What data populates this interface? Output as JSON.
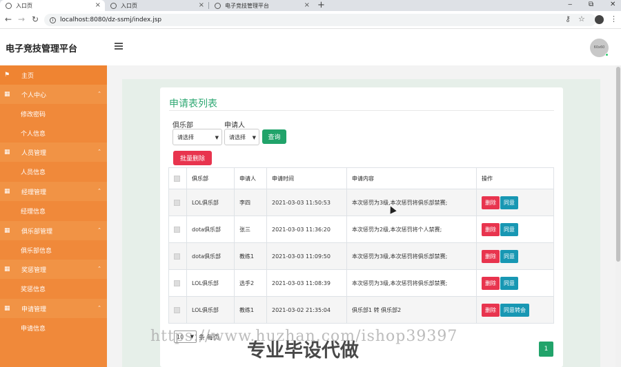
{
  "browser": {
    "tabs": [
      {
        "title": "入口页"
      },
      {
        "title": "入口页"
      },
      {
        "title": "电子竞技管理平台"
      }
    ],
    "url": "localhost:8080/dz-ssmj/index.jsp",
    "win_min": "‒",
    "win_max": "⧉",
    "win_close": "✕"
  },
  "header": {
    "brand": "电子竞技管理平台",
    "avatar_text": "60x60"
  },
  "sidebar": {
    "home": "主页",
    "groups": [
      {
        "label": "个人中心",
        "children": [
          "修改密码",
          "个人信息"
        ]
      },
      {
        "label": "人员管理",
        "children": [
          "人员信息"
        ]
      },
      {
        "label": "经理管理",
        "children": [
          "经理信息"
        ]
      },
      {
        "label": "俱乐部管理",
        "children": [
          "俱乐部信息"
        ]
      },
      {
        "label": "奖惩管理",
        "children": [
          "奖惩信息"
        ]
      },
      {
        "label": "申请管理",
        "children": [
          "申请信息"
        ]
      }
    ]
  },
  "main": {
    "title": "申请表列表",
    "filters": {
      "club_label": "俱乐部",
      "club_value": "请选择",
      "applicant_label": "申请人",
      "applicant_value": "请选择",
      "query_button": "查询"
    },
    "batch_delete": "批量删除",
    "table": {
      "headers": [
        "俱乐部",
        "申请人",
        "申请时间",
        "申请内容",
        "操作"
      ],
      "rows": [
        {
          "club": "LOL俱乐部",
          "applicant": "李四",
          "time": "2021-03-03 11:50:53",
          "content": "本次惩罚为3级,本次惩罚将俱乐部禁赛;",
          "actions": [
            "删除",
            "同意"
          ]
        },
        {
          "club": "dota俱乐部",
          "applicant": "张三",
          "time": "2021-03-03 11:36:20",
          "content": "本次惩罚为2级,本次惩罚将个人禁赛;",
          "actions": [
            "删除",
            "同意"
          ]
        },
        {
          "club": "dota俱乐部",
          "applicant": "教练1",
          "time": "2021-03-03 11:09:50",
          "content": "本次惩罚为3级,本次惩罚将俱乐部禁赛;",
          "actions": [
            "删除",
            "同意"
          ]
        },
        {
          "club": "LOL俱乐部",
          "applicant": "选手2",
          "time": "2021-03-03 11:08:39",
          "content": "本次惩罚为3级,本次惩罚将俱乐部禁赛;",
          "actions": [
            "删除",
            "同意"
          ]
        },
        {
          "club": "LOL俱乐部",
          "applicant": "教练1",
          "time": "2021-03-02 21:35:04",
          "content": "俱乐部1 转 俱乐部2",
          "actions": [
            "删除",
            "同意转会"
          ]
        }
      ]
    },
    "pager": {
      "page_size": "10",
      "per_page_text": "条 每页",
      "current_page": "1"
    }
  },
  "watermark": {
    "url_text": "https://www.huzhan.com/ishop39397",
    "slogan": "专业毕设代做"
  },
  "colors": {
    "sidebar": "#f0893a",
    "primary_green": "#21a36a",
    "danger": "#e8344e",
    "info": "#1897b3"
  }
}
